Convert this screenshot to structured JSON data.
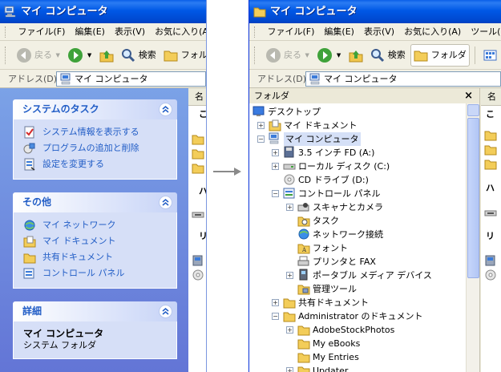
{
  "left_window": {
    "title": "マイ コンピュータ",
    "menu": [
      "ファイル(F)",
      "編集(E)",
      "表示(V)",
      "お気に入り(A)"
    ],
    "toolbar": {
      "back": "戻る",
      "search": "検索",
      "folders": "フォル"
    },
    "address_label": "アドレス(D)",
    "address_value": "マイ コンピュータ",
    "system_tasks": {
      "title": "システムのタスク",
      "items": [
        "システム情報を表示する",
        "プログラムの追加と削除",
        "設定を変更する"
      ]
    },
    "other_places": {
      "title": "その他",
      "items": [
        "マイ ネットワーク",
        "マイ ドキュメント",
        "共有ドキュメント",
        "コントロール パネル"
      ]
    },
    "details": {
      "title": "詳細",
      "name": "マイ コンピュータ",
      "subtitle": "システム フォルダ"
    },
    "files_header": "名",
    "group_letters": [
      "こ",
      "ハ",
      "リ"
    ]
  },
  "right_window": {
    "title": "マイ コンピュータ",
    "menu": [
      "ファイル(F)",
      "編集(E)",
      "表示(V)",
      "お気に入り(A)",
      "ツール("
    ],
    "toolbar": {
      "back": "戻る",
      "search": "検索",
      "folders": "フォルダ"
    },
    "address_label": "アドレス(D)",
    "address_value": "マイ コンピュータ",
    "folders_pane_title": "フォルダ",
    "close_symbol": "×",
    "files_header": "名",
    "group_letters": [
      "こ",
      "ハ",
      "リ"
    ],
    "tree": [
      {
        "label": "デスクトップ",
        "depth": 0,
        "expander": "",
        "icon": "desktop-icon"
      },
      {
        "label": "マイ ドキュメント",
        "depth": 1,
        "expander": "+",
        "icon": "my-documents-icon"
      },
      {
        "label": "マイ コンピュータ",
        "depth": 1,
        "expander": "−",
        "icon": "my-computer-icon",
        "selected": true
      },
      {
        "label": "3.5 インチ FD (A:)",
        "depth": 2,
        "expander": "+",
        "icon": "floppy-drive-icon"
      },
      {
        "label": "ローカル ディスク (C:)",
        "depth": 2,
        "expander": "+",
        "icon": "hard-disk-icon"
      },
      {
        "label": "CD ドライブ (D:)",
        "depth": 2,
        "expander": "",
        "icon": "cd-drive-icon"
      },
      {
        "label": "コントロール パネル",
        "depth": 2,
        "expander": "−",
        "icon": "control-panel-icon"
      },
      {
        "label": "スキャナとカメラ",
        "depth": 3,
        "expander": "+",
        "icon": "scanner-camera-icon"
      },
      {
        "label": "タスク",
        "depth": 3,
        "expander": "",
        "icon": "scheduled-tasks-icon"
      },
      {
        "label": "ネットワーク接続",
        "depth": 3,
        "expander": "",
        "icon": "network-connections-icon"
      },
      {
        "label": "フォント",
        "depth": 3,
        "expander": "",
        "icon": "fonts-icon"
      },
      {
        "label": "プリンタと FAX",
        "depth": 3,
        "expander": "",
        "icon": "printers-fax-icon"
      },
      {
        "label": "ポータブル メディア デバイス",
        "depth": 3,
        "expander": "+",
        "icon": "portable-media-icon"
      },
      {
        "label": "管理ツール",
        "depth": 3,
        "expander": "",
        "icon": "admin-tools-icon"
      },
      {
        "label": "共有ドキュメント",
        "depth": 2,
        "expander": "+",
        "icon": "folder-icon"
      },
      {
        "label": "Administrator のドキュメント",
        "depth": 2,
        "expander": "−",
        "icon": "folder-icon"
      },
      {
        "label": "AdobeStockPhotos",
        "depth": 3,
        "expander": "+",
        "icon": "folder-icon"
      },
      {
        "label": "My eBooks",
        "depth": 3,
        "expander": "",
        "icon": "folder-icon"
      },
      {
        "label": "My Entries",
        "depth": 3,
        "expander": "",
        "icon": "folder-icon"
      },
      {
        "label": "Updater",
        "depth": 3,
        "expander": "+",
        "icon": "folder-icon"
      }
    ]
  }
}
